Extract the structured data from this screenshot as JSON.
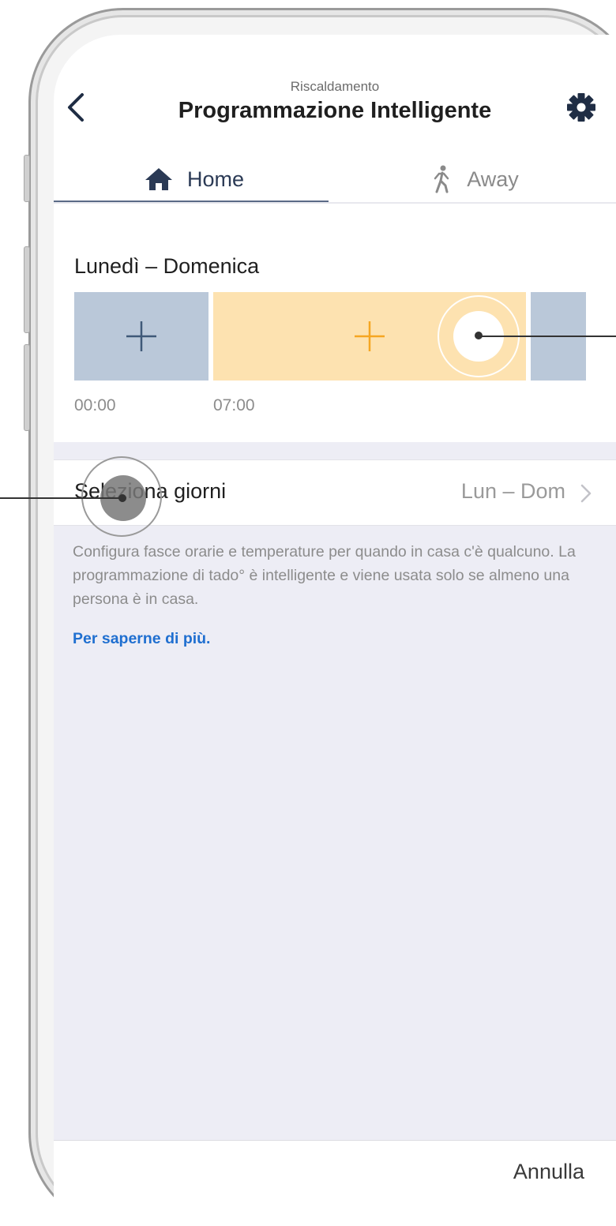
{
  "header": {
    "subtitle": "Riscaldamento",
    "title": "Programmazione Intelligente",
    "back_icon": "chevron-left-icon",
    "settings_icon": "gear-icon"
  },
  "tabs": [
    {
      "label": "Home",
      "icon": "house-icon",
      "selected": true
    },
    {
      "label": "Away",
      "icon": "walking-person-icon",
      "selected": false
    }
  ],
  "schedule": {
    "days_label": "Lunedì – Domenica",
    "blocks": [
      {
        "start": "00:00",
        "color": "#bac8d9",
        "add_color": "#3f5978"
      },
      {
        "start": "07:00",
        "color": "#fde2b0",
        "add_color": "#f5a623"
      },
      {
        "start": "",
        "color": "#bac8d9"
      }
    ]
  },
  "select_days": {
    "label": "Seleziona giorni",
    "value": "Lun – Dom"
  },
  "info": {
    "text": "Configura fasce orarie e temperature per quando in casa c'è qualcuno. La programmazione di tado° è intelligente e viene usata solo se almeno una persona è in casa.",
    "link": "Per saperne di più."
  },
  "footer": {
    "cancel_label": "Annulla"
  },
  "colors": {
    "accent_link": "#1f6fd0",
    "home_tab": "#2b3a55",
    "background": "#ededf5"
  }
}
